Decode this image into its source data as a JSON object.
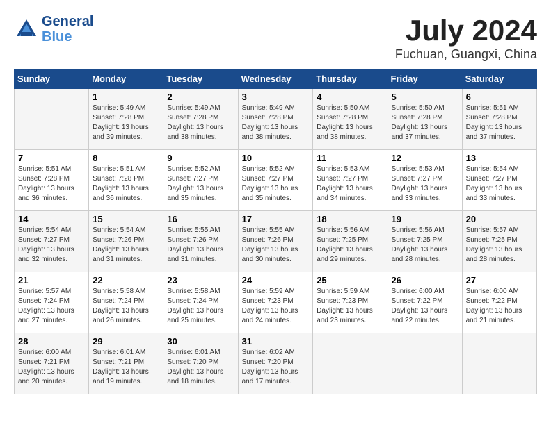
{
  "header": {
    "logo_line1": "General",
    "logo_line2": "Blue",
    "month": "July 2024",
    "location": "Fuchuan, Guangxi, China"
  },
  "weekdays": [
    "Sunday",
    "Monday",
    "Tuesday",
    "Wednesday",
    "Thursday",
    "Friday",
    "Saturday"
  ],
  "weeks": [
    [
      {
        "day": "",
        "info": ""
      },
      {
        "day": "1",
        "info": "Sunrise: 5:49 AM\nSunset: 7:28 PM\nDaylight: 13 hours\nand 39 minutes."
      },
      {
        "day": "2",
        "info": "Sunrise: 5:49 AM\nSunset: 7:28 PM\nDaylight: 13 hours\nand 38 minutes."
      },
      {
        "day": "3",
        "info": "Sunrise: 5:49 AM\nSunset: 7:28 PM\nDaylight: 13 hours\nand 38 minutes."
      },
      {
        "day": "4",
        "info": "Sunrise: 5:50 AM\nSunset: 7:28 PM\nDaylight: 13 hours\nand 38 minutes."
      },
      {
        "day": "5",
        "info": "Sunrise: 5:50 AM\nSunset: 7:28 PM\nDaylight: 13 hours\nand 37 minutes."
      },
      {
        "day": "6",
        "info": "Sunrise: 5:51 AM\nSunset: 7:28 PM\nDaylight: 13 hours\nand 37 minutes."
      }
    ],
    [
      {
        "day": "7",
        "info": "Sunrise: 5:51 AM\nSunset: 7:28 PM\nDaylight: 13 hours\nand 36 minutes."
      },
      {
        "day": "8",
        "info": "Sunrise: 5:51 AM\nSunset: 7:28 PM\nDaylight: 13 hours\nand 36 minutes."
      },
      {
        "day": "9",
        "info": "Sunrise: 5:52 AM\nSunset: 7:27 PM\nDaylight: 13 hours\nand 35 minutes."
      },
      {
        "day": "10",
        "info": "Sunrise: 5:52 AM\nSunset: 7:27 PM\nDaylight: 13 hours\nand 35 minutes."
      },
      {
        "day": "11",
        "info": "Sunrise: 5:53 AM\nSunset: 7:27 PM\nDaylight: 13 hours\nand 34 minutes."
      },
      {
        "day": "12",
        "info": "Sunrise: 5:53 AM\nSunset: 7:27 PM\nDaylight: 13 hours\nand 33 minutes."
      },
      {
        "day": "13",
        "info": "Sunrise: 5:54 AM\nSunset: 7:27 PM\nDaylight: 13 hours\nand 33 minutes."
      }
    ],
    [
      {
        "day": "14",
        "info": "Sunrise: 5:54 AM\nSunset: 7:27 PM\nDaylight: 13 hours\nand 32 minutes."
      },
      {
        "day": "15",
        "info": "Sunrise: 5:54 AM\nSunset: 7:26 PM\nDaylight: 13 hours\nand 31 minutes."
      },
      {
        "day": "16",
        "info": "Sunrise: 5:55 AM\nSunset: 7:26 PM\nDaylight: 13 hours\nand 31 minutes."
      },
      {
        "day": "17",
        "info": "Sunrise: 5:55 AM\nSunset: 7:26 PM\nDaylight: 13 hours\nand 30 minutes."
      },
      {
        "day": "18",
        "info": "Sunrise: 5:56 AM\nSunset: 7:25 PM\nDaylight: 13 hours\nand 29 minutes."
      },
      {
        "day": "19",
        "info": "Sunrise: 5:56 AM\nSunset: 7:25 PM\nDaylight: 13 hours\nand 28 minutes."
      },
      {
        "day": "20",
        "info": "Sunrise: 5:57 AM\nSunset: 7:25 PM\nDaylight: 13 hours\nand 28 minutes."
      }
    ],
    [
      {
        "day": "21",
        "info": "Sunrise: 5:57 AM\nSunset: 7:24 PM\nDaylight: 13 hours\nand 27 minutes."
      },
      {
        "day": "22",
        "info": "Sunrise: 5:58 AM\nSunset: 7:24 PM\nDaylight: 13 hours\nand 26 minutes."
      },
      {
        "day": "23",
        "info": "Sunrise: 5:58 AM\nSunset: 7:24 PM\nDaylight: 13 hours\nand 25 minutes."
      },
      {
        "day": "24",
        "info": "Sunrise: 5:59 AM\nSunset: 7:23 PM\nDaylight: 13 hours\nand 24 minutes."
      },
      {
        "day": "25",
        "info": "Sunrise: 5:59 AM\nSunset: 7:23 PM\nDaylight: 13 hours\nand 23 minutes."
      },
      {
        "day": "26",
        "info": "Sunrise: 6:00 AM\nSunset: 7:22 PM\nDaylight: 13 hours\nand 22 minutes."
      },
      {
        "day": "27",
        "info": "Sunrise: 6:00 AM\nSunset: 7:22 PM\nDaylight: 13 hours\nand 21 minutes."
      }
    ],
    [
      {
        "day": "28",
        "info": "Sunrise: 6:00 AM\nSunset: 7:21 PM\nDaylight: 13 hours\nand 20 minutes."
      },
      {
        "day": "29",
        "info": "Sunrise: 6:01 AM\nSunset: 7:21 PM\nDaylight: 13 hours\nand 19 minutes."
      },
      {
        "day": "30",
        "info": "Sunrise: 6:01 AM\nSunset: 7:20 PM\nDaylight: 13 hours\nand 18 minutes."
      },
      {
        "day": "31",
        "info": "Sunrise: 6:02 AM\nSunset: 7:20 PM\nDaylight: 13 hours\nand 17 minutes."
      },
      {
        "day": "",
        "info": ""
      },
      {
        "day": "",
        "info": ""
      },
      {
        "day": "",
        "info": ""
      }
    ]
  ]
}
